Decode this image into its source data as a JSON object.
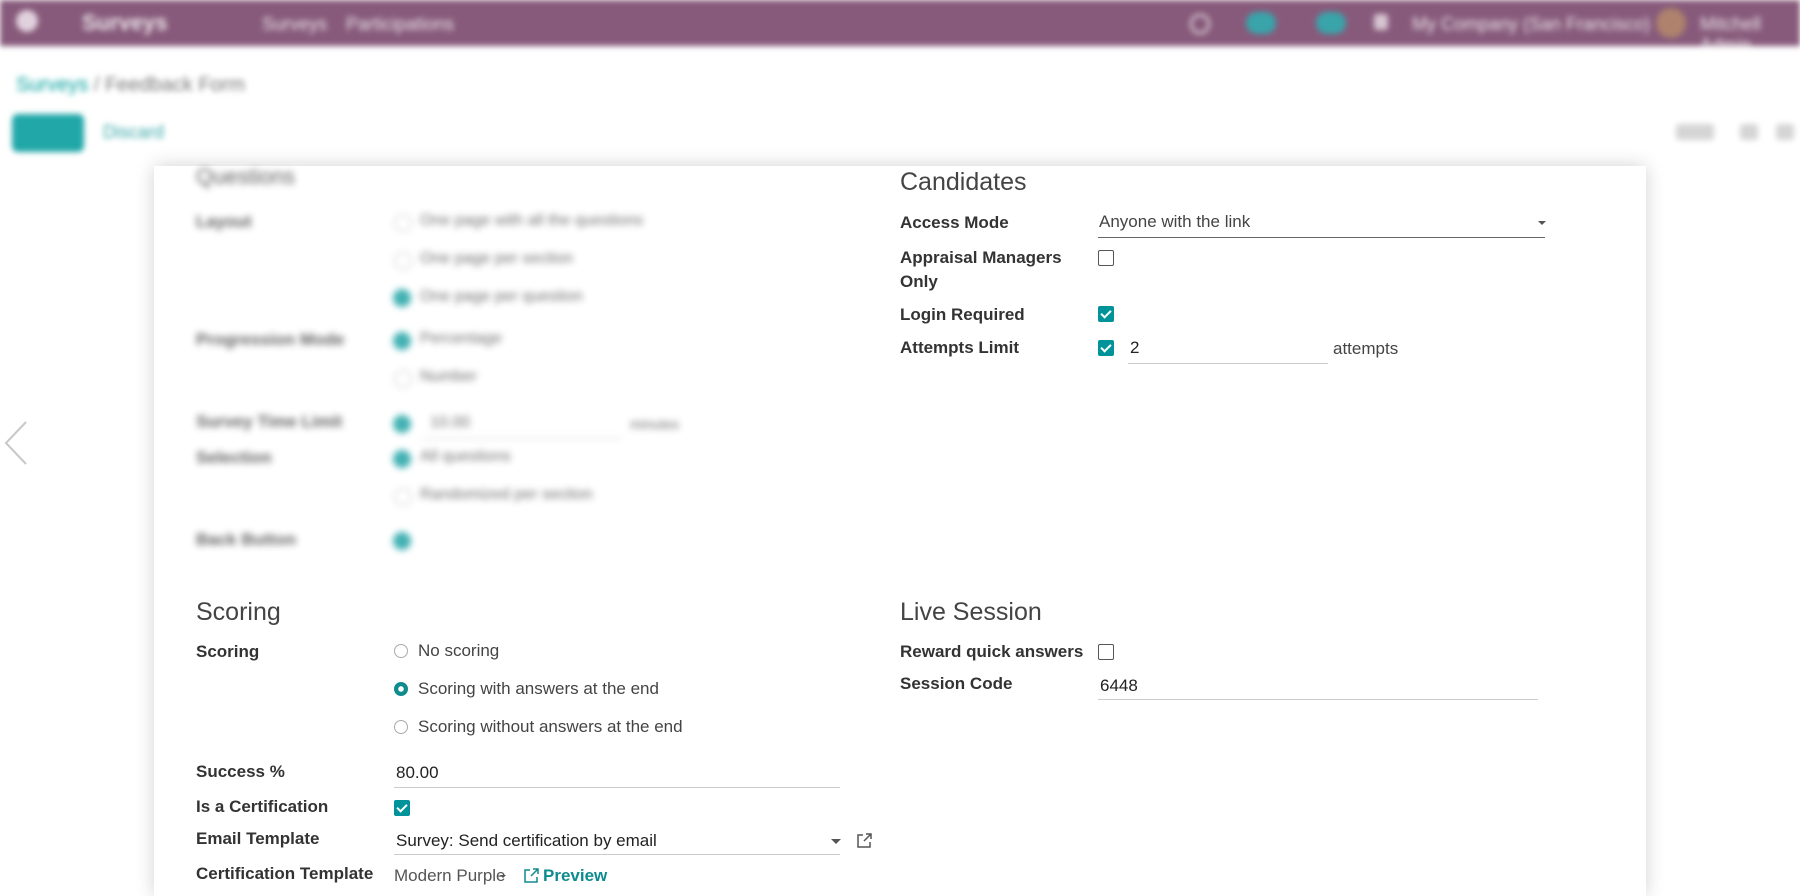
{
  "navbar": {
    "logo": "Surveys",
    "menu": [
      "Surveys",
      "Participations"
    ],
    "company": "My Company (San Francisco)",
    "user": "Mitchell Admin"
  },
  "breadcrumb": {
    "root": "Surveys",
    "current": "Feedback Form"
  },
  "control_panel": {
    "save_label": "Save",
    "discard_label": "Discard"
  },
  "blurred_questions": {
    "title": "Questions",
    "layout_label": "Layout",
    "layout_options": [
      "One page with all the questions",
      "One page per section",
      "One page per question"
    ],
    "progression_label": "Progression Mode",
    "progression_options": [
      "Percentage",
      "Number"
    ],
    "time_limit_label": "Survey Time Limit",
    "time_limit_value": "10.00",
    "time_limit_unit": "minutes",
    "selection_label": "Selection",
    "selection_options": [
      "All questions",
      "Randomized per section"
    ],
    "back_button_label": "Back Button"
  },
  "candidates": {
    "title": "Candidates",
    "access_mode_label": "Access Mode",
    "access_mode_value": "Anyone with the link",
    "appraisal_label": "Appraisal Managers Only",
    "appraisal_checked": false,
    "login_label": "Login Required",
    "login_checked": true,
    "attempts_label": "Attempts Limit",
    "attempts_checked": true,
    "attempts_value": "2",
    "attempts_unit": "attempts"
  },
  "scoring": {
    "title": "Scoring",
    "scoring_label": "Scoring",
    "options": [
      "No scoring",
      "Scoring with answers at the end",
      "Scoring without answers at the end"
    ],
    "selected_index": 1,
    "success_label": "Success %",
    "success_value": "80.00",
    "certification_label": "Is a Certification",
    "certification_checked": true,
    "email_template_label": "Email Template",
    "email_template_value": "Survey: Send certification by email",
    "cert_template_label": "Certification Template",
    "cert_template_value": "Modern Purple",
    "preview_label": "Preview"
  },
  "live_session": {
    "title": "Live Session",
    "reward_label": "Reward quick answers",
    "reward_checked": false,
    "session_code_label": "Session Code",
    "session_code_value": "6448"
  },
  "colors": {
    "navbar": "#875a7b",
    "accent": "#01939a",
    "link": "#0f8c8e"
  }
}
